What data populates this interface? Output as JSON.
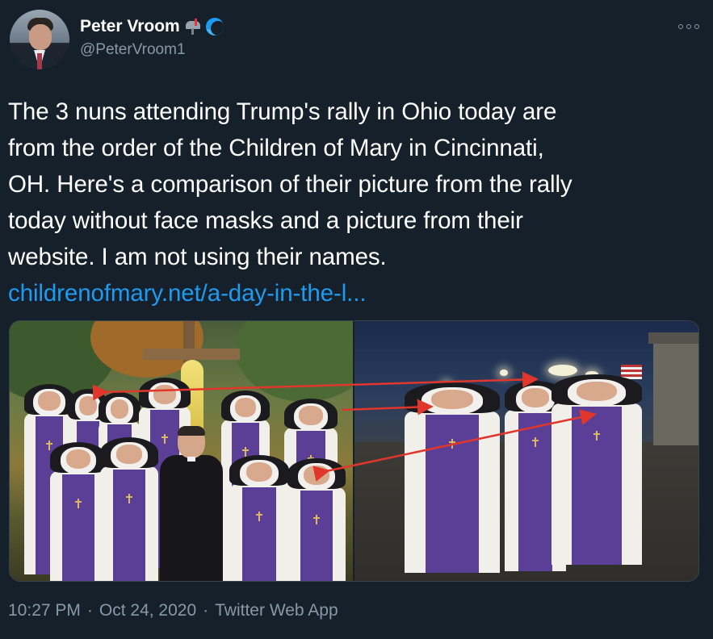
{
  "author": {
    "display_name": "Peter Vroom",
    "handle": "@PeterVroom1",
    "emojis": [
      "mailbox-with-flag-icon",
      "water-wave-icon"
    ]
  },
  "tweet": {
    "lines": [
      "The 3 nuns attending Trump's rally in Ohio today are",
      "from the order of the Children of Mary in Cincinnati,",
      "OH. Here's a comparison of their picture from the rally",
      "today without face masks and a picture from their",
      "website. I am not using their names."
    ],
    "link": "childrenofmary.net/a-day-in-the-l..."
  },
  "media": {
    "arrow_color": "#e0362c"
  },
  "meta": {
    "time": "10:27 PM",
    "separator": "·",
    "date": "Oct 24, 2020",
    "source": "Twitter Web App"
  },
  "colors": {
    "background": "#15202b",
    "link": "#1d9bf0",
    "secondary_text": "#8899a6"
  }
}
